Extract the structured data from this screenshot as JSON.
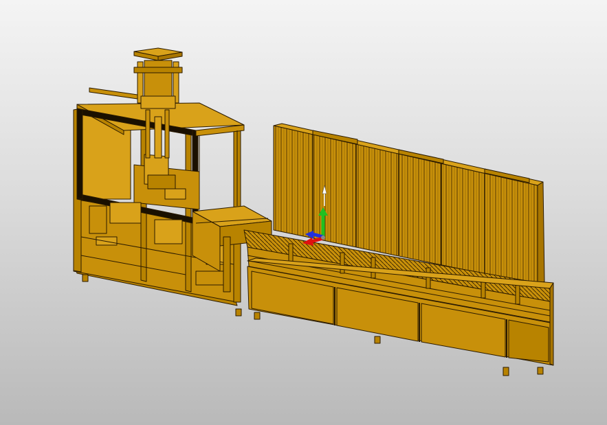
{
  "viewport": {
    "background_top": "#f4f4f4",
    "background_bottom": "#b9b9b9"
  },
  "model": {
    "body_color": "#c8900a",
    "body_light": "#d9a21a",
    "body_dark": "#a87500",
    "edge_color": "#2a1a00"
  },
  "triad": {
    "x_axis_color": "#e01010",
    "y_axis_color": "#20c020",
    "z_axis_color": "#2030e0",
    "icon": "coordinate-axis-triad-icon"
  }
}
